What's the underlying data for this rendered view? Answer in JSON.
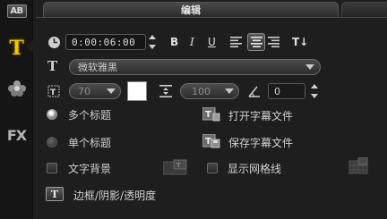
{
  "sidebar": {
    "ab_label": "AB",
    "title_tool_glyph": "T",
    "fx_label": "FX",
    "icons": [
      "title-ab-icon",
      "title-text-icon",
      "flower-icon",
      "fx-icon"
    ]
  },
  "tabs": {
    "edit": "编辑"
  },
  "timecode": {
    "value": "0:00:06:00"
  },
  "format": {
    "bold": "B",
    "italic": "I",
    "underline": "U",
    "text_orientation": "T↓"
  },
  "font": {
    "name": "微软雅黑",
    "glyph": "T"
  },
  "size": {
    "value": "70"
  },
  "color": {
    "text_color": "#ffffff"
  },
  "line_spacing": {
    "value": "100"
  },
  "rotation": {
    "value": "0"
  },
  "options": {
    "multi_title": "多个标题",
    "single_title": "单个标题",
    "text_background": "文字背景",
    "open_subtitle": "打开字幕文件",
    "save_subtitle": "保存字幕文件",
    "show_grid": "显示网格线",
    "border_shadow": "边框/阴影/透明度",
    "border_glyph": "T",
    "selected": "multi_title"
  },
  "colors": {
    "accent": "#f0c400",
    "background": "#1e1e1e",
    "panel": "#151515"
  }
}
